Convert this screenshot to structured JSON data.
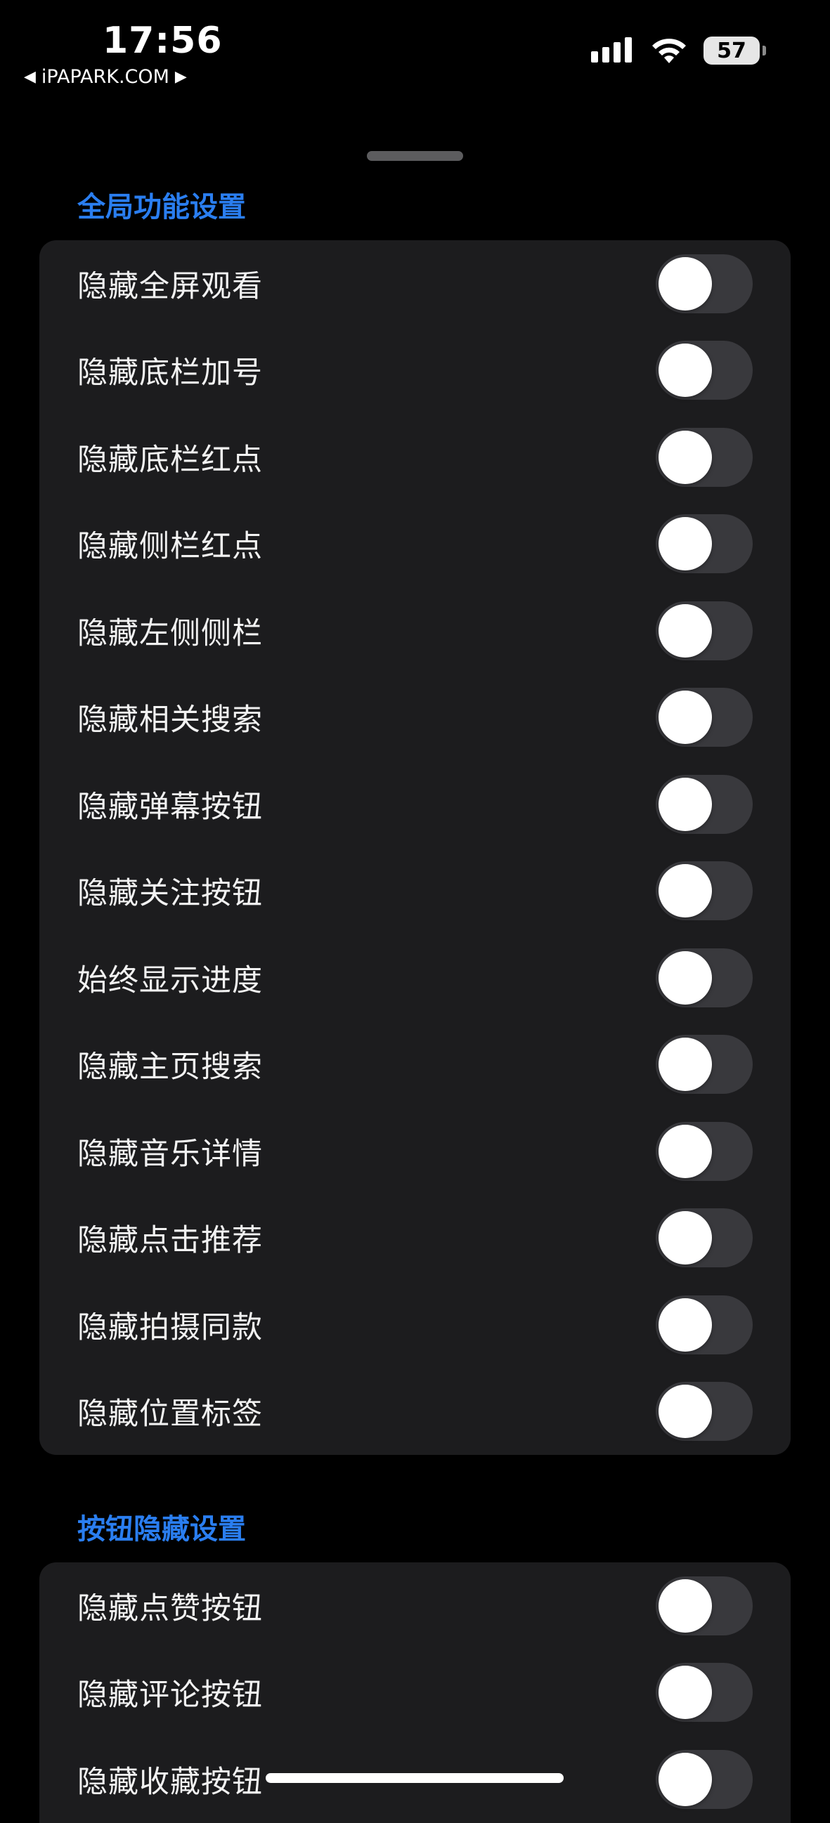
{
  "status_bar": {
    "time": "17:56",
    "carrier": "iPAPARK.COM",
    "carrier_left_glyph": "◀",
    "carrier_right_glyph": "▶",
    "battery": "57",
    "icons": [
      "cellular-signal-icon",
      "wifi-icon",
      "battery-icon"
    ]
  },
  "sections": [
    {
      "title": "全局功能设置",
      "items": [
        {
          "label": "隐藏全屏观看",
          "on": false
        },
        {
          "label": "隐藏底栏加号",
          "on": false
        },
        {
          "label": "隐藏底栏红点",
          "on": false
        },
        {
          "label": "隐藏侧栏红点",
          "on": false
        },
        {
          "label": "隐藏左侧侧栏",
          "on": false
        },
        {
          "label": "隐藏相关搜索",
          "on": false
        },
        {
          "label": "隐藏弹幕按钮",
          "on": false
        },
        {
          "label": "隐藏关注按钮",
          "on": false
        },
        {
          "label": "始终显示进度",
          "on": false
        },
        {
          "label": "隐藏主页搜索",
          "on": false
        },
        {
          "label": "隐藏音乐详情",
          "on": false
        },
        {
          "label": "隐藏点击推荐",
          "on": false
        },
        {
          "label": "隐藏拍摄同款",
          "on": false
        },
        {
          "label": "隐藏位置标签",
          "on": false
        }
      ]
    },
    {
      "title": "按钮隐藏设置",
      "items": [
        {
          "label": "隐藏点赞按钮",
          "on": false
        },
        {
          "label": "隐藏评论按钮",
          "on": false
        },
        {
          "label": "隐藏收藏按钮",
          "on": false
        }
      ]
    }
  ],
  "colors": {
    "background": "#000000",
    "group_background": "#1c1c1e",
    "section_header": "#2a7ef0",
    "toggle_off_track": "#39393d",
    "toggle_knob": "#ffffff"
  }
}
